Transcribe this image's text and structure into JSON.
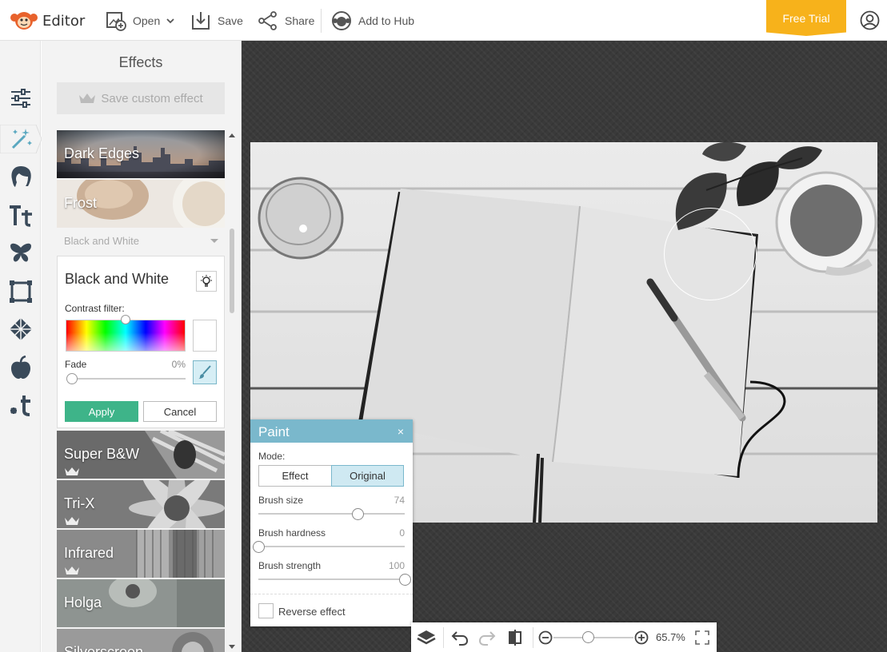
{
  "topbar": {
    "app_title": "Editor",
    "open_label": "Open",
    "save_label": "Save",
    "share_label": "Share",
    "hub_label": "Add to Hub",
    "trial_label": "Free Trial"
  },
  "rail": {
    "icons": [
      "adjustments-icon",
      "effects-wand-icon",
      "touch-up-face-icon",
      "text-icon",
      "butterfly-graphics-icon",
      "frame-icon",
      "textures-icon",
      "seasonal-apple-icon",
      "themes-icon"
    ],
    "active": "effects-wand-icon"
  },
  "effects_panel": {
    "title": "Effects",
    "save_custom_label": "Save custom effect",
    "category_label": "Black and White",
    "thumbnails": [
      {
        "label": "Dark Edges",
        "premium": false
      },
      {
        "label": "Frost",
        "premium": false
      },
      {
        "label": "Super B&W",
        "premium": true
      },
      {
        "label": "Tri-X",
        "premium": true
      },
      {
        "label": "Infrared",
        "premium": true
      },
      {
        "label": "Holga",
        "premium": false
      },
      {
        "label": "Silverscreen",
        "premium": false
      }
    ],
    "active_effect": {
      "title": "Black and White",
      "contrast_label": "Contrast filter:",
      "fade_label": "Fade",
      "fade_value": "0%",
      "fade_fraction": 0,
      "contrast_hue_fraction": 0.5,
      "apply_label": "Apply",
      "cancel_label": "Cancel"
    }
  },
  "paint_panel": {
    "title": "Paint",
    "close_label": "×",
    "mode_label": "Mode:",
    "mode_options": [
      "Effect",
      "Original"
    ],
    "mode_selected": "Original",
    "brush_size_label": "Brush size",
    "brush_size_value": "74",
    "brush_size_fraction": 0.68,
    "brush_hardness_label": "Brush hardness",
    "brush_hardness_value": "0",
    "brush_hardness_fraction": 0,
    "brush_strength_label": "Brush strength",
    "brush_strength_value": "100",
    "brush_strength_fraction": 1,
    "reverse_label": "Reverse effect",
    "reverse_checked": false
  },
  "bottom_bar": {
    "zoom_value": "65.7%",
    "zoom_fraction": 0.43
  },
  "colors": {
    "accent": "#7ab8cc",
    "apply": "#3eb489",
    "trial": "#f7b21b",
    "logo": "#e8622c"
  }
}
